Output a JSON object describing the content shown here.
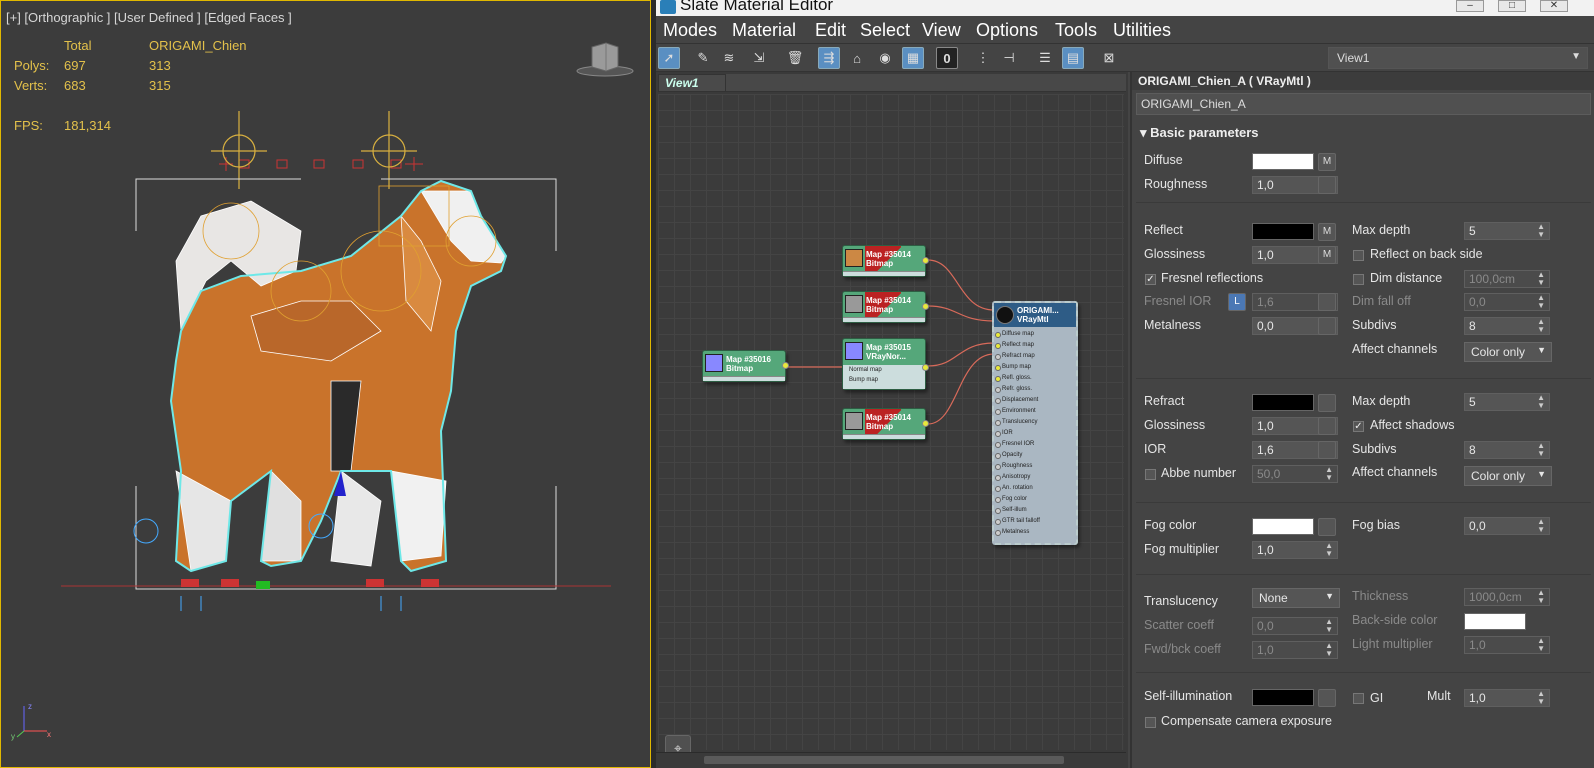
{
  "viewport": {
    "label": "[+] [Orthographic ] [User Defined ] [Edged Faces ]",
    "stats": {
      "total_header": "Total",
      "object_name": "ORIGAMI_Chien",
      "polys_label": "Polys:",
      "polys_total": "697",
      "polys_object": "313",
      "verts_label": "Verts:",
      "verts_total": "683",
      "verts_object": "315",
      "fps_label": "FPS:",
      "fps_value": "181,314"
    },
    "axis": {
      "x": "x",
      "y": "y",
      "z": "z"
    }
  },
  "editor": {
    "title": "Slate Material Editor",
    "menu": [
      "Modes",
      "Material",
      "Edit",
      "Select",
      "View",
      "Options",
      "Tools",
      "Utilities"
    ],
    "view_select": "View1",
    "view_tab": "View1",
    "toolbar_number": "0"
  },
  "nodes": {
    "map1": {
      "name": "Map #35014",
      "type": "Bitmap"
    },
    "map2": {
      "name": "Map #35014",
      "type": "Bitmap"
    },
    "map3": {
      "name": "Map #35015",
      "type": "VRayNor...",
      "slot1": "Normal map",
      "slot2": "Bump map"
    },
    "map4": {
      "name": "Map #35014",
      "type": "Bitmap"
    },
    "map5": {
      "name": "Map #35016",
      "type": "Bitmap"
    },
    "material": {
      "name": "ORIGAMI...",
      "type": "VRayMtl",
      "slots": [
        "Diffuse map",
        "Reflect map",
        "Refract map",
        "Bump map",
        "Refl. gloss.",
        "Refr. gloss.",
        "Displacement",
        "Environment",
        "Translucency",
        "IOR",
        "Fresnel IOR",
        "Opacity",
        "Roughness",
        "Anisotropy",
        "An. rotation",
        "Fog color",
        "Self-illum",
        "GTR tail falloff",
        "Metalness"
      ]
    }
  },
  "params": {
    "title": "ORIGAMI_Chien_A  ( VRayMtl )",
    "name_field": "ORIGAMI_Chien_A",
    "rollout": "Basic parameters",
    "diffuse": {
      "label": "Diffuse",
      "color": "#ffffff",
      "m": "M"
    },
    "roughness": {
      "label": "Roughness",
      "value": "1,0"
    },
    "reflect": {
      "label": "Reflect",
      "color": "#000000",
      "m": "M"
    },
    "refl_gloss": {
      "label": "Glossiness",
      "value": "1,0",
      "m": "M"
    },
    "fresnel": {
      "label": "Fresnel reflections",
      "checked": true
    },
    "fresnel_ior": {
      "label": "Fresnel IOR",
      "value": "1,6",
      "l": "L"
    },
    "metalness": {
      "label": "Metalness",
      "value": "0,0"
    },
    "refl_maxdepth": {
      "label": "Max depth",
      "value": "5"
    },
    "reflect_back": {
      "label": "Reflect on back side",
      "checked": false
    },
    "dim_distance": {
      "label": "Dim distance",
      "checked": false,
      "value": "100,0cm"
    },
    "dim_falloff": {
      "label": "Dim fall off",
      "value": "0,0"
    },
    "refl_subdivs": {
      "label": "Subdivs",
      "value": "8"
    },
    "refl_affect": {
      "label": "Affect channels",
      "value": "Color only"
    },
    "refract": {
      "label": "Refract",
      "color": "#000000"
    },
    "refr_gloss": {
      "label": "Glossiness",
      "value": "1,0"
    },
    "ior": {
      "label": "IOR",
      "value": "1,6"
    },
    "abbe": {
      "label": "Abbe number",
      "checked": false,
      "value": "50,0"
    },
    "refr_maxdepth": {
      "label": "Max depth",
      "value": "5"
    },
    "affect_shadows": {
      "label": "Affect shadows",
      "checked": true
    },
    "refr_subdivs": {
      "label": "Subdivs",
      "value": "8"
    },
    "refr_affect": {
      "label": "Affect channels",
      "value": "Color only"
    },
    "fog_color": {
      "label": "Fog color",
      "color": "#ffffff"
    },
    "fog_mult": {
      "label": "Fog multiplier",
      "value": "1,0"
    },
    "fog_bias": {
      "label": "Fog bias",
      "value": "0,0"
    },
    "translucency": {
      "label": "Translucency",
      "value": "None"
    },
    "thickness": {
      "label": "Thickness",
      "value": "1000,0cm"
    },
    "scatter": {
      "label": "Scatter coeff",
      "value": "0,0"
    },
    "backside": {
      "label": "Back-side color",
      "color": "#ffffff"
    },
    "fwd": {
      "label": "Fwd/bck coeff",
      "value": "1,0"
    },
    "light_mult": {
      "label": "Light multiplier",
      "value": "1,0"
    },
    "self_illum": {
      "label": "Self-illumination",
      "color": "#000000"
    },
    "gi": {
      "label": "GI",
      "checked": false
    },
    "mult": {
      "label": "Mult",
      "value": "1,0"
    },
    "compensate": {
      "label": "Compensate camera exposure",
      "checked": false
    }
  }
}
